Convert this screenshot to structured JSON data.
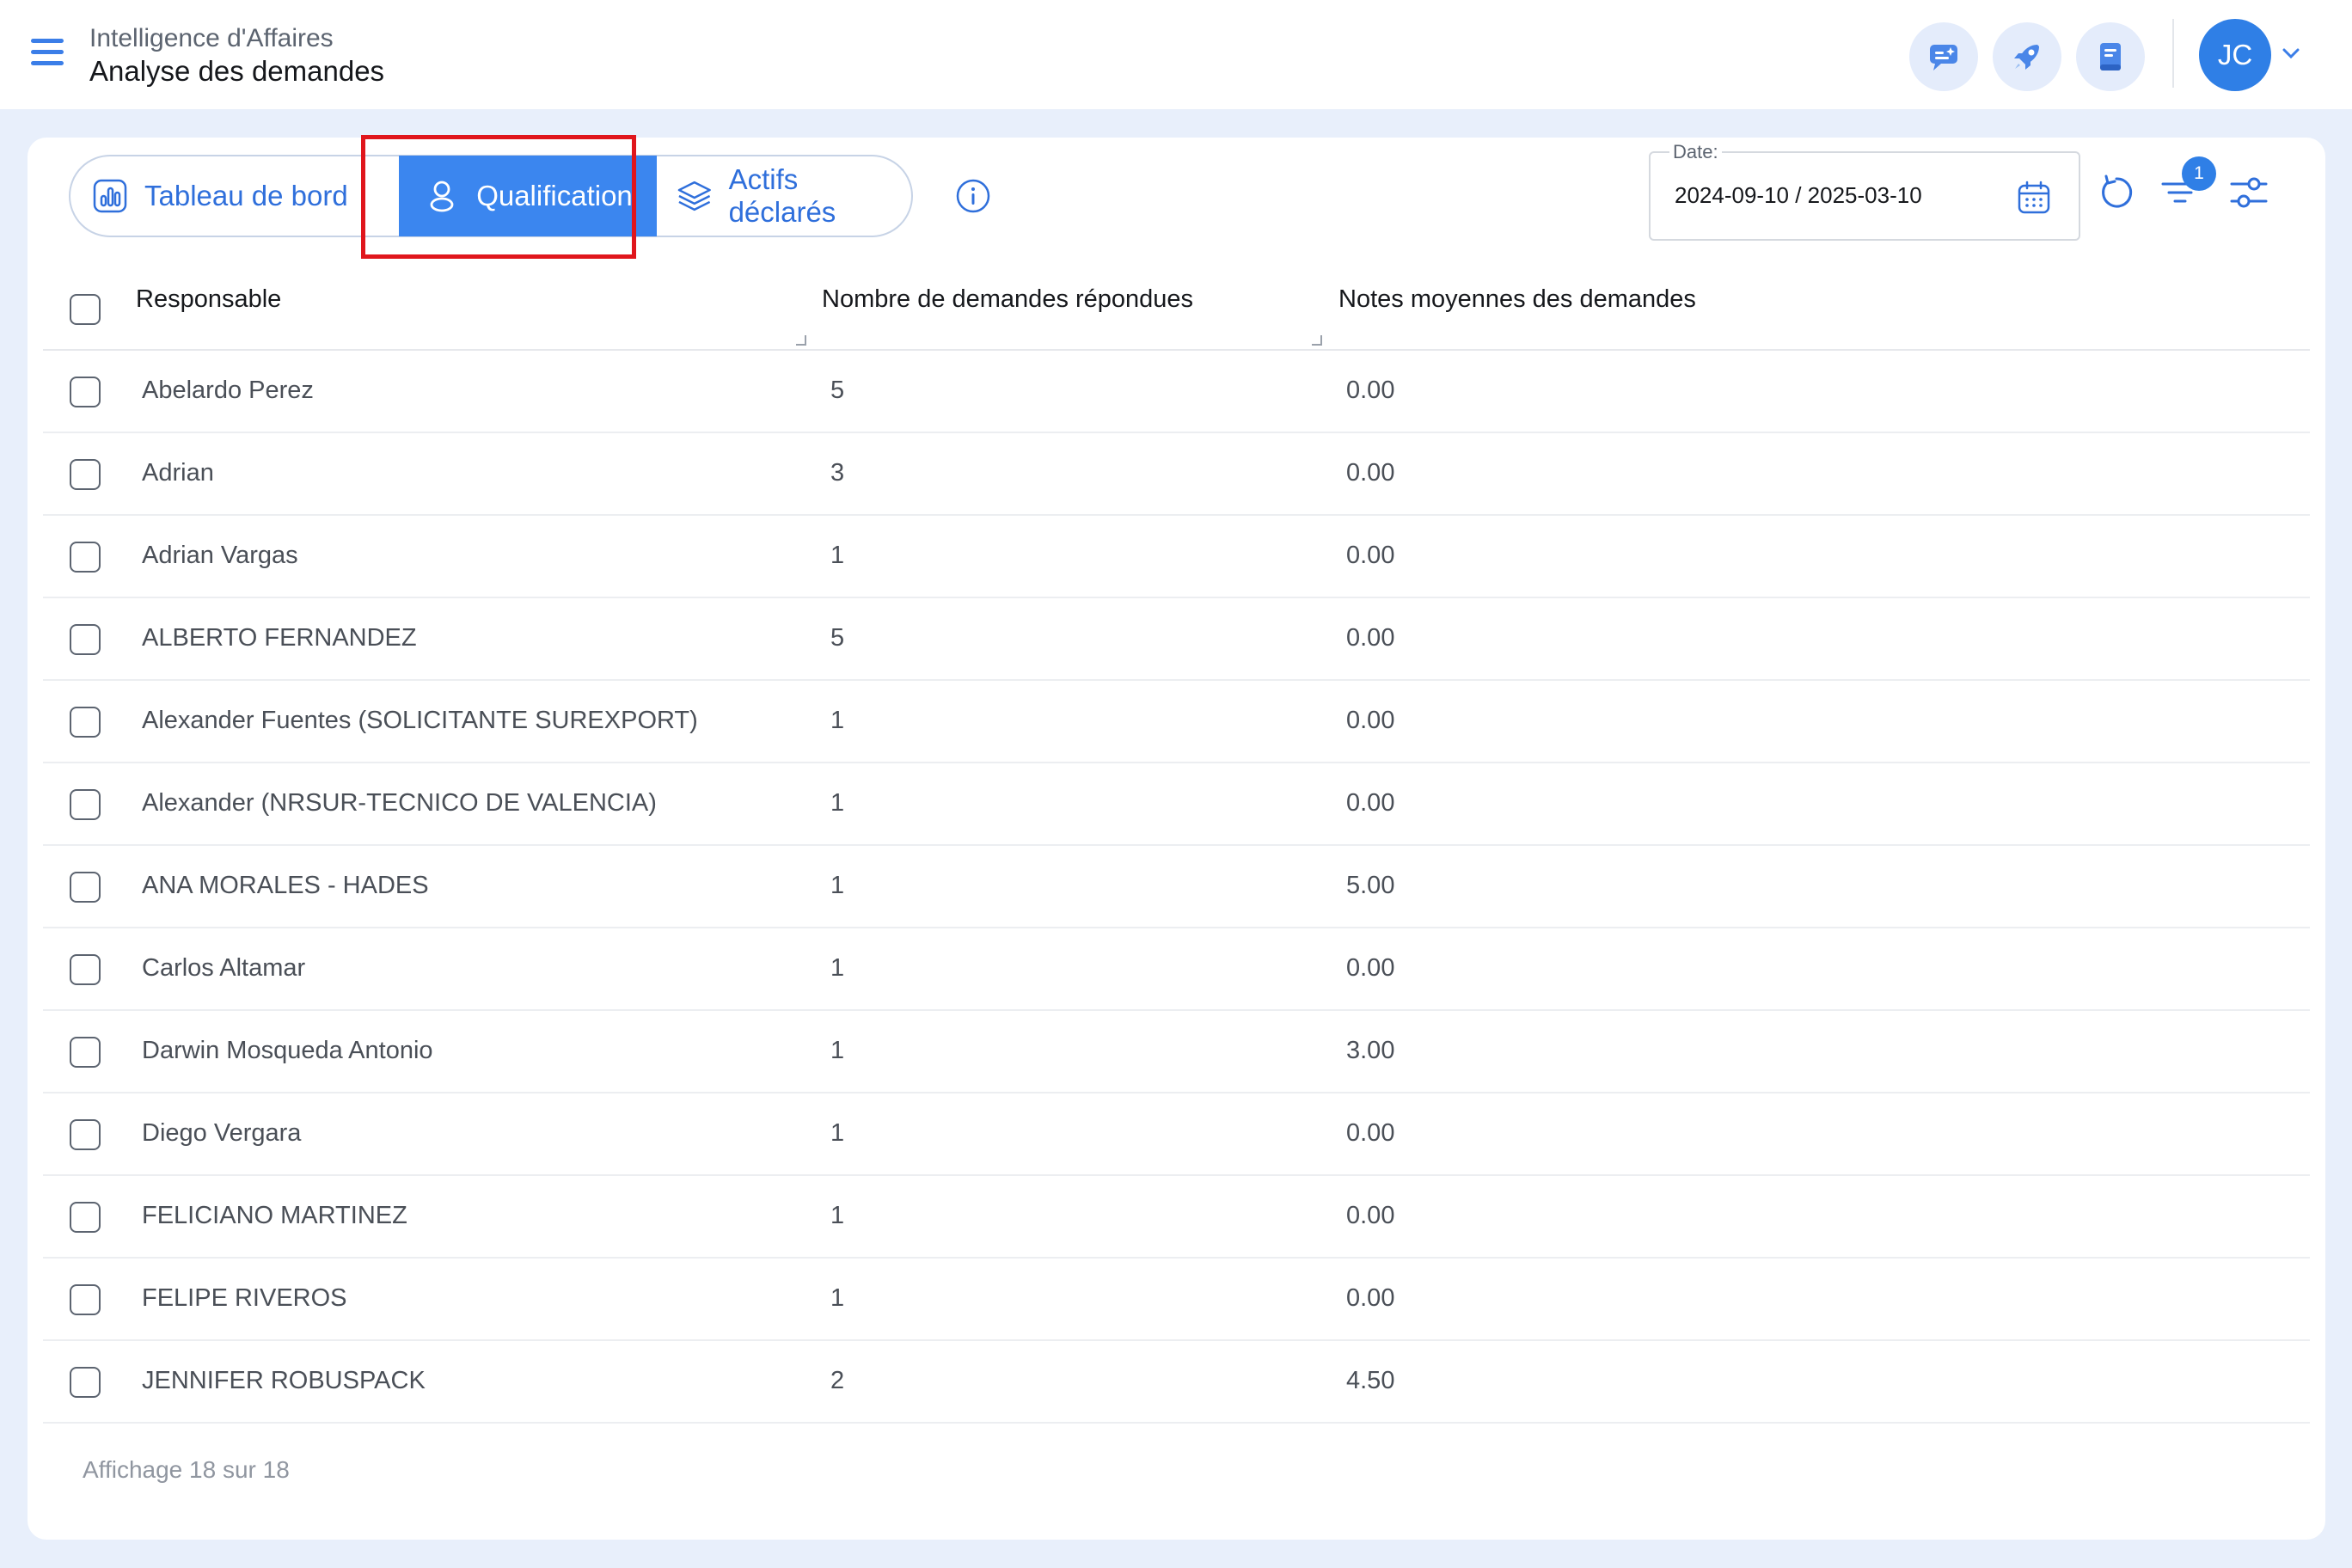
{
  "header": {
    "section": "Intelligence d'Affaires",
    "title": "Analyse des demandes",
    "avatar_initials": "JC",
    "actions": [
      "chat-ai-icon",
      "rocket-icon",
      "book-icon"
    ]
  },
  "tabs": {
    "dashboard": "Tableau de bord",
    "qualification": "Qualification",
    "assets": "Actifs déclarés",
    "active": "Qualification"
  },
  "filters": {
    "date_label": "Date:",
    "date_value": "2024-09-10 / 2025-03-10",
    "filter_count": "1"
  },
  "table": {
    "columns": [
      "Responsable",
      "Nombre de demandes répondues",
      "Notes moyennes des demandes"
    ],
    "rows": [
      {
        "name": "Abelardo Perez",
        "count": "5",
        "rating": "0.00"
      },
      {
        "name": "Adrian",
        "count": "3",
        "rating": "0.00"
      },
      {
        "name": "Adrian Vargas",
        "count": "1",
        "rating": "0.00"
      },
      {
        "name": "ALBERTO FERNANDEZ",
        "count": "5",
        "rating": "0.00"
      },
      {
        "name": "Alexander Fuentes (SOLICITANTE SUREXPORT)",
        "count": "1",
        "rating": "0.00"
      },
      {
        "name": "Alexander (NRSUR-TECNICO DE VALENCIA)",
        "count": "1",
        "rating": "0.00"
      },
      {
        "name": "ANA MORALES - HADES",
        "count": "1",
        "rating": "5.00"
      },
      {
        "name": "Carlos Altamar",
        "count": "1",
        "rating": "0.00"
      },
      {
        "name": "Darwin Mosqueda Antonio",
        "count": "1",
        "rating": "3.00"
      },
      {
        "name": "Diego Vergara",
        "count": "1",
        "rating": "0.00"
      },
      {
        "name": "FELICIANO MARTINEZ",
        "count": "1",
        "rating": "0.00"
      },
      {
        "name": "FELIPE RIVEROS",
        "count": "1",
        "rating": "0.00"
      },
      {
        "name": "JENNIFER ROBUSPACK",
        "count": "2",
        "rating": "4.50"
      }
    ]
  },
  "footer": {
    "pagination": "Affichage 18 sur 18"
  },
  "colors": {
    "accent": "#3b86ef",
    "highlight": "#e0161c",
    "background": "#e8effb"
  }
}
